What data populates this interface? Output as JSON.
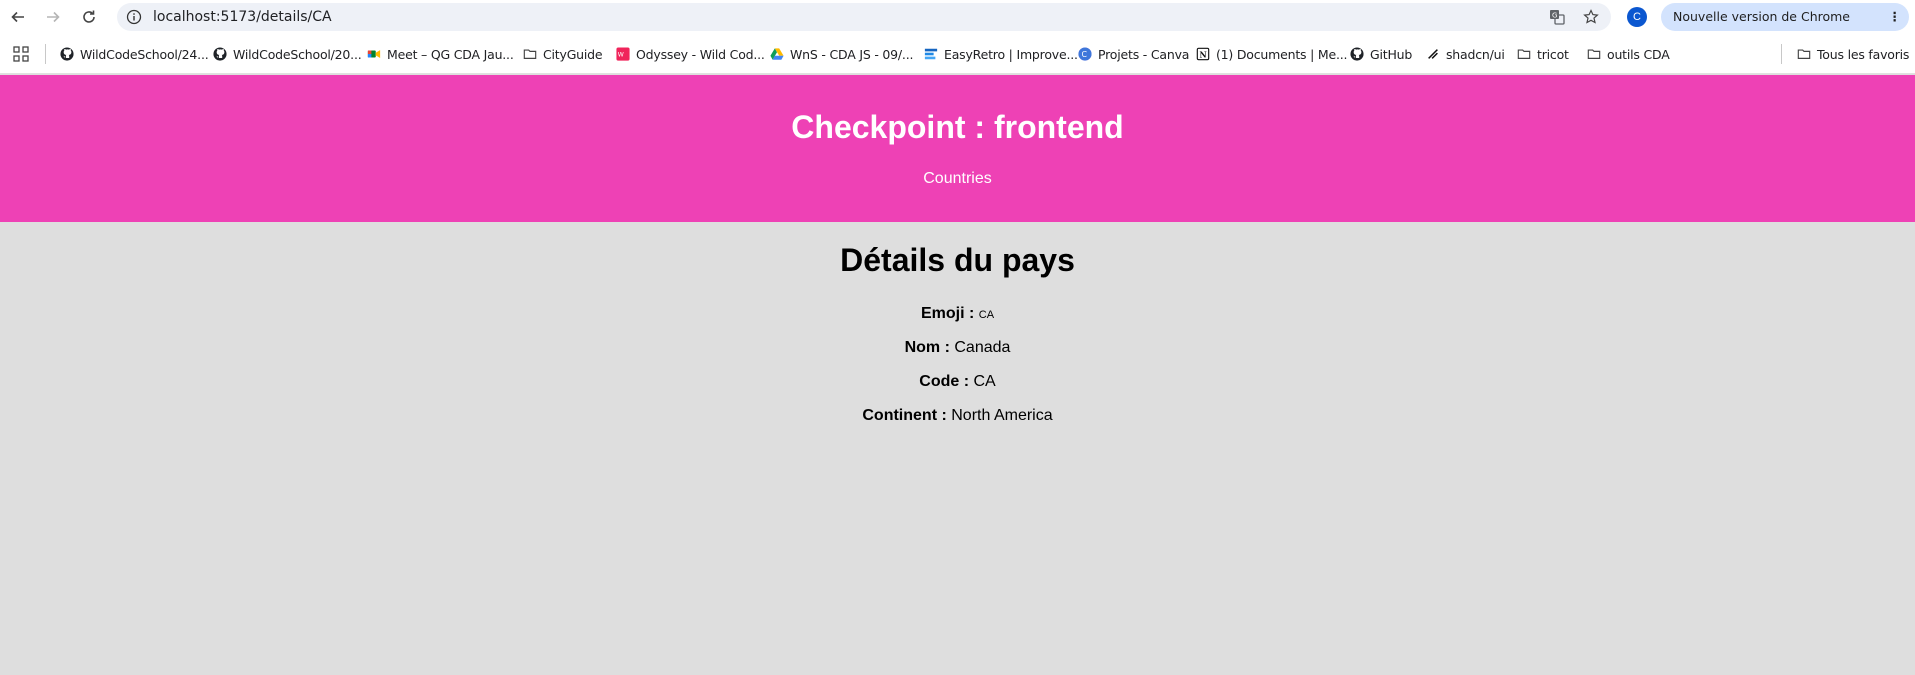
{
  "browser": {
    "url": "localhost:5173/details/CA",
    "profile_initial": "C",
    "update_label": "Nouvelle version de Chrome disponible",
    "bookmarks": [
      {
        "label": "WildCodeSchool/24...",
        "icon": "github-icon"
      },
      {
        "label": "WildCodeSchool/20...",
        "icon": "github-icon"
      },
      {
        "label": "Meet – QG CDA Jau...",
        "icon": "google-meet-icon"
      },
      {
        "label": "CityGuide",
        "icon": "folder-icon"
      },
      {
        "label": "Odyssey - Wild Cod...",
        "icon": "odyssey-icon"
      },
      {
        "label": "WnS - CDA JS - 09/...",
        "icon": "google-drive-icon"
      },
      {
        "label": "EasyRetro | Improve...",
        "icon": "easyretro-icon"
      },
      {
        "label": "Projets - Canva",
        "icon": "canva-icon"
      },
      {
        "label": "(1) Documents | Me...",
        "icon": "notion-icon"
      },
      {
        "label": "GitHub",
        "icon": "github-icon"
      },
      {
        "label": "shadcn/ui",
        "icon": "shadcn-icon"
      },
      {
        "label": "tricot",
        "icon": "folder-icon"
      },
      {
        "label": "outils CDA",
        "icon": "folder-icon"
      }
    ],
    "all_bookmarks_label": "Tous les favoris",
    "colors": {
      "header": "#ee41b5",
      "background": "#dedede",
      "chip": "#d3e3fd"
    }
  },
  "header": {
    "title": "Checkpoint : frontend",
    "nav_link": "Countries"
  },
  "main": {
    "heading": "Détails du pays",
    "details": [
      {
        "label": "Emoji :",
        "value": "CA"
      },
      {
        "label": "Nom :",
        "value": "Canada"
      },
      {
        "label": "Code :",
        "value": "CA"
      },
      {
        "label": "Continent :",
        "value": "North America"
      }
    ]
  }
}
